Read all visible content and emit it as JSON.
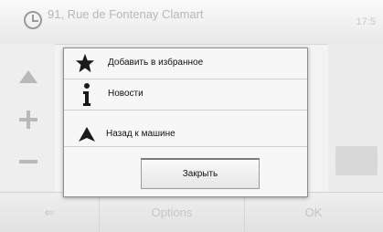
{
  "header": {
    "address": "91, Rue de Fontenay Clamart",
    "time": "17:5"
  },
  "popup": {
    "items": [
      {
        "label": "Добавить в избранное",
        "icon": "star-icon"
      },
      {
        "label": "Новости",
        "icon": "info-icon"
      },
      {
        "label": "Назад к машине",
        "icon": "navigation-arrow-icon"
      }
    ],
    "close_label": "Закрыть"
  },
  "bottom_bar": {
    "back_label": "⇐",
    "options_label": "Options",
    "ok_label": "OK"
  },
  "colors": {
    "popup_bg": "#f7f7f7",
    "dimmed_text": "#c6c6c6",
    "icon_dark": "#1a1a1a"
  }
}
